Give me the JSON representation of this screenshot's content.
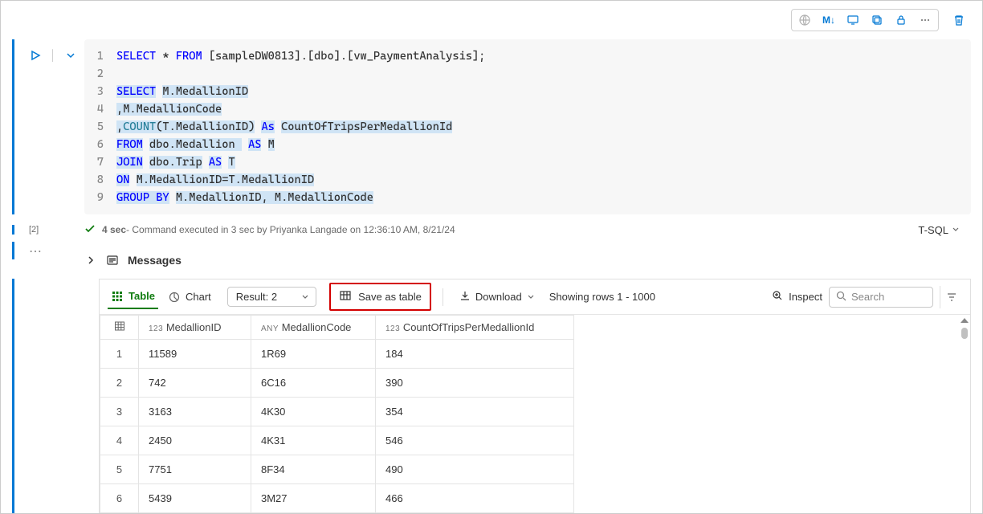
{
  "sql": {
    "lines": [
      {
        "n": 1,
        "tokens": [
          {
            "t": "SELECT",
            "c": "kw"
          },
          {
            "t": " * "
          },
          {
            "t": "FROM",
            "c": "kw"
          },
          {
            "t": " [sampleDW0813].[dbo].[vw_PaymentAnalysis];"
          }
        ]
      },
      {
        "n": 2,
        "tokens": []
      },
      {
        "n": 3,
        "tokens": [
          {
            "t": "SELECT",
            "c": "kw hl"
          },
          {
            "t": " "
          },
          {
            "t": "M.MedallionID",
            "c": "hl"
          }
        ]
      },
      {
        "n": 4,
        "tokens": [
          {
            "t": ",M.MedallionCode",
            "c": "hl"
          }
        ]
      },
      {
        "n": 5,
        "tokens": [
          {
            "t": ",",
            "c": "hl"
          },
          {
            "t": "COUNT",
            "c": "fn hl"
          },
          {
            "t": "(T.MedallionID)",
            "c": "hl"
          },
          {
            "t": " "
          },
          {
            "t": "As",
            "c": "kw hl"
          },
          {
            "t": " "
          },
          {
            "t": "CountOfTripsPerMedallionId",
            "c": "hl"
          }
        ]
      },
      {
        "n": 6,
        "tokens": [
          {
            "t": "FROM",
            "c": "kw hl"
          },
          {
            "t": " "
          },
          {
            "t": "dbo.Medallion ",
            "c": "hl"
          },
          {
            "t": " "
          },
          {
            "t": "AS",
            "c": "kw hl"
          },
          {
            "t": " "
          },
          {
            "t": "M",
            "c": "hl"
          }
        ]
      },
      {
        "n": 7,
        "tokens": [
          {
            "t": "JOIN",
            "c": "kw hl"
          },
          {
            "t": " "
          },
          {
            "t": "dbo.Trip",
            "c": "hl"
          },
          {
            "t": " "
          },
          {
            "t": "AS",
            "c": "kw hl"
          },
          {
            "t": " "
          },
          {
            "t": "T",
            "c": "hl"
          }
        ]
      },
      {
        "n": 8,
        "tokens": [
          {
            "t": "ON",
            "c": "kw hl"
          },
          {
            "t": " "
          },
          {
            "t": "M.MedallionID=T.MedallionID",
            "c": "hl"
          }
        ]
      },
      {
        "n": 9,
        "tokens": [
          {
            "t": "GROUP BY",
            "c": "kw hl"
          },
          {
            "t": " "
          },
          {
            "t": "M.MedallionID, M.MedallionCode",
            "c": "hl"
          }
        ]
      }
    ]
  },
  "status": {
    "cell_index": "[2]",
    "duration": "4 sec",
    "message": " - Command executed in 3 sec by Priyanka Langade on 12:36:10 AM, 8/21/24",
    "language": "T-SQL"
  },
  "messages_label": "Messages",
  "results": {
    "tabs": {
      "table": "Table",
      "chart": "Chart"
    },
    "result_selector": "Result: 2",
    "save_as_table": "Save as table",
    "download": "Download",
    "rows_showing": "Showing rows 1 - 1000",
    "inspect": "Inspect",
    "search_placeholder": "Search",
    "columns": [
      {
        "type": "123",
        "name": "MedallionID"
      },
      {
        "type": "ANY",
        "name": "MedallionCode"
      },
      {
        "type": "123",
        "name": "CountOfTripsPerMedallionId"
      }
    ],
    "rows": [
      {
        "n": 1,
        "MedallionID": "11589",
        "MedallionCode": "1R69",
        "Count": "184"
      },
      {
        "n": 2,
        "MedallionID": "742",
        "MedallionCode": "6C16",
        "Count": "390"
      },
      {
        "n": 3,
        "MedallionID": "3163",
        "MedallionCode": "4K30",
        "Count": "354"
      },
      {
        "n": 4,
        "MedallionID": "2450",
        "MedallionCode": "4K31",
        "Count": "546"
      },
      {
        "n": 5,
        "MedallionID": "7751",
        "MedallionCode": "8F34",
        "Count": "490"
      },
      {
        "n": 6,
        "MedallionID": "5439",
        "MedallionCode": "3M27",
        "Count": "466"
      }
    ]
  },
  "icons": {
    "markdown": "M↓"
  }
}
